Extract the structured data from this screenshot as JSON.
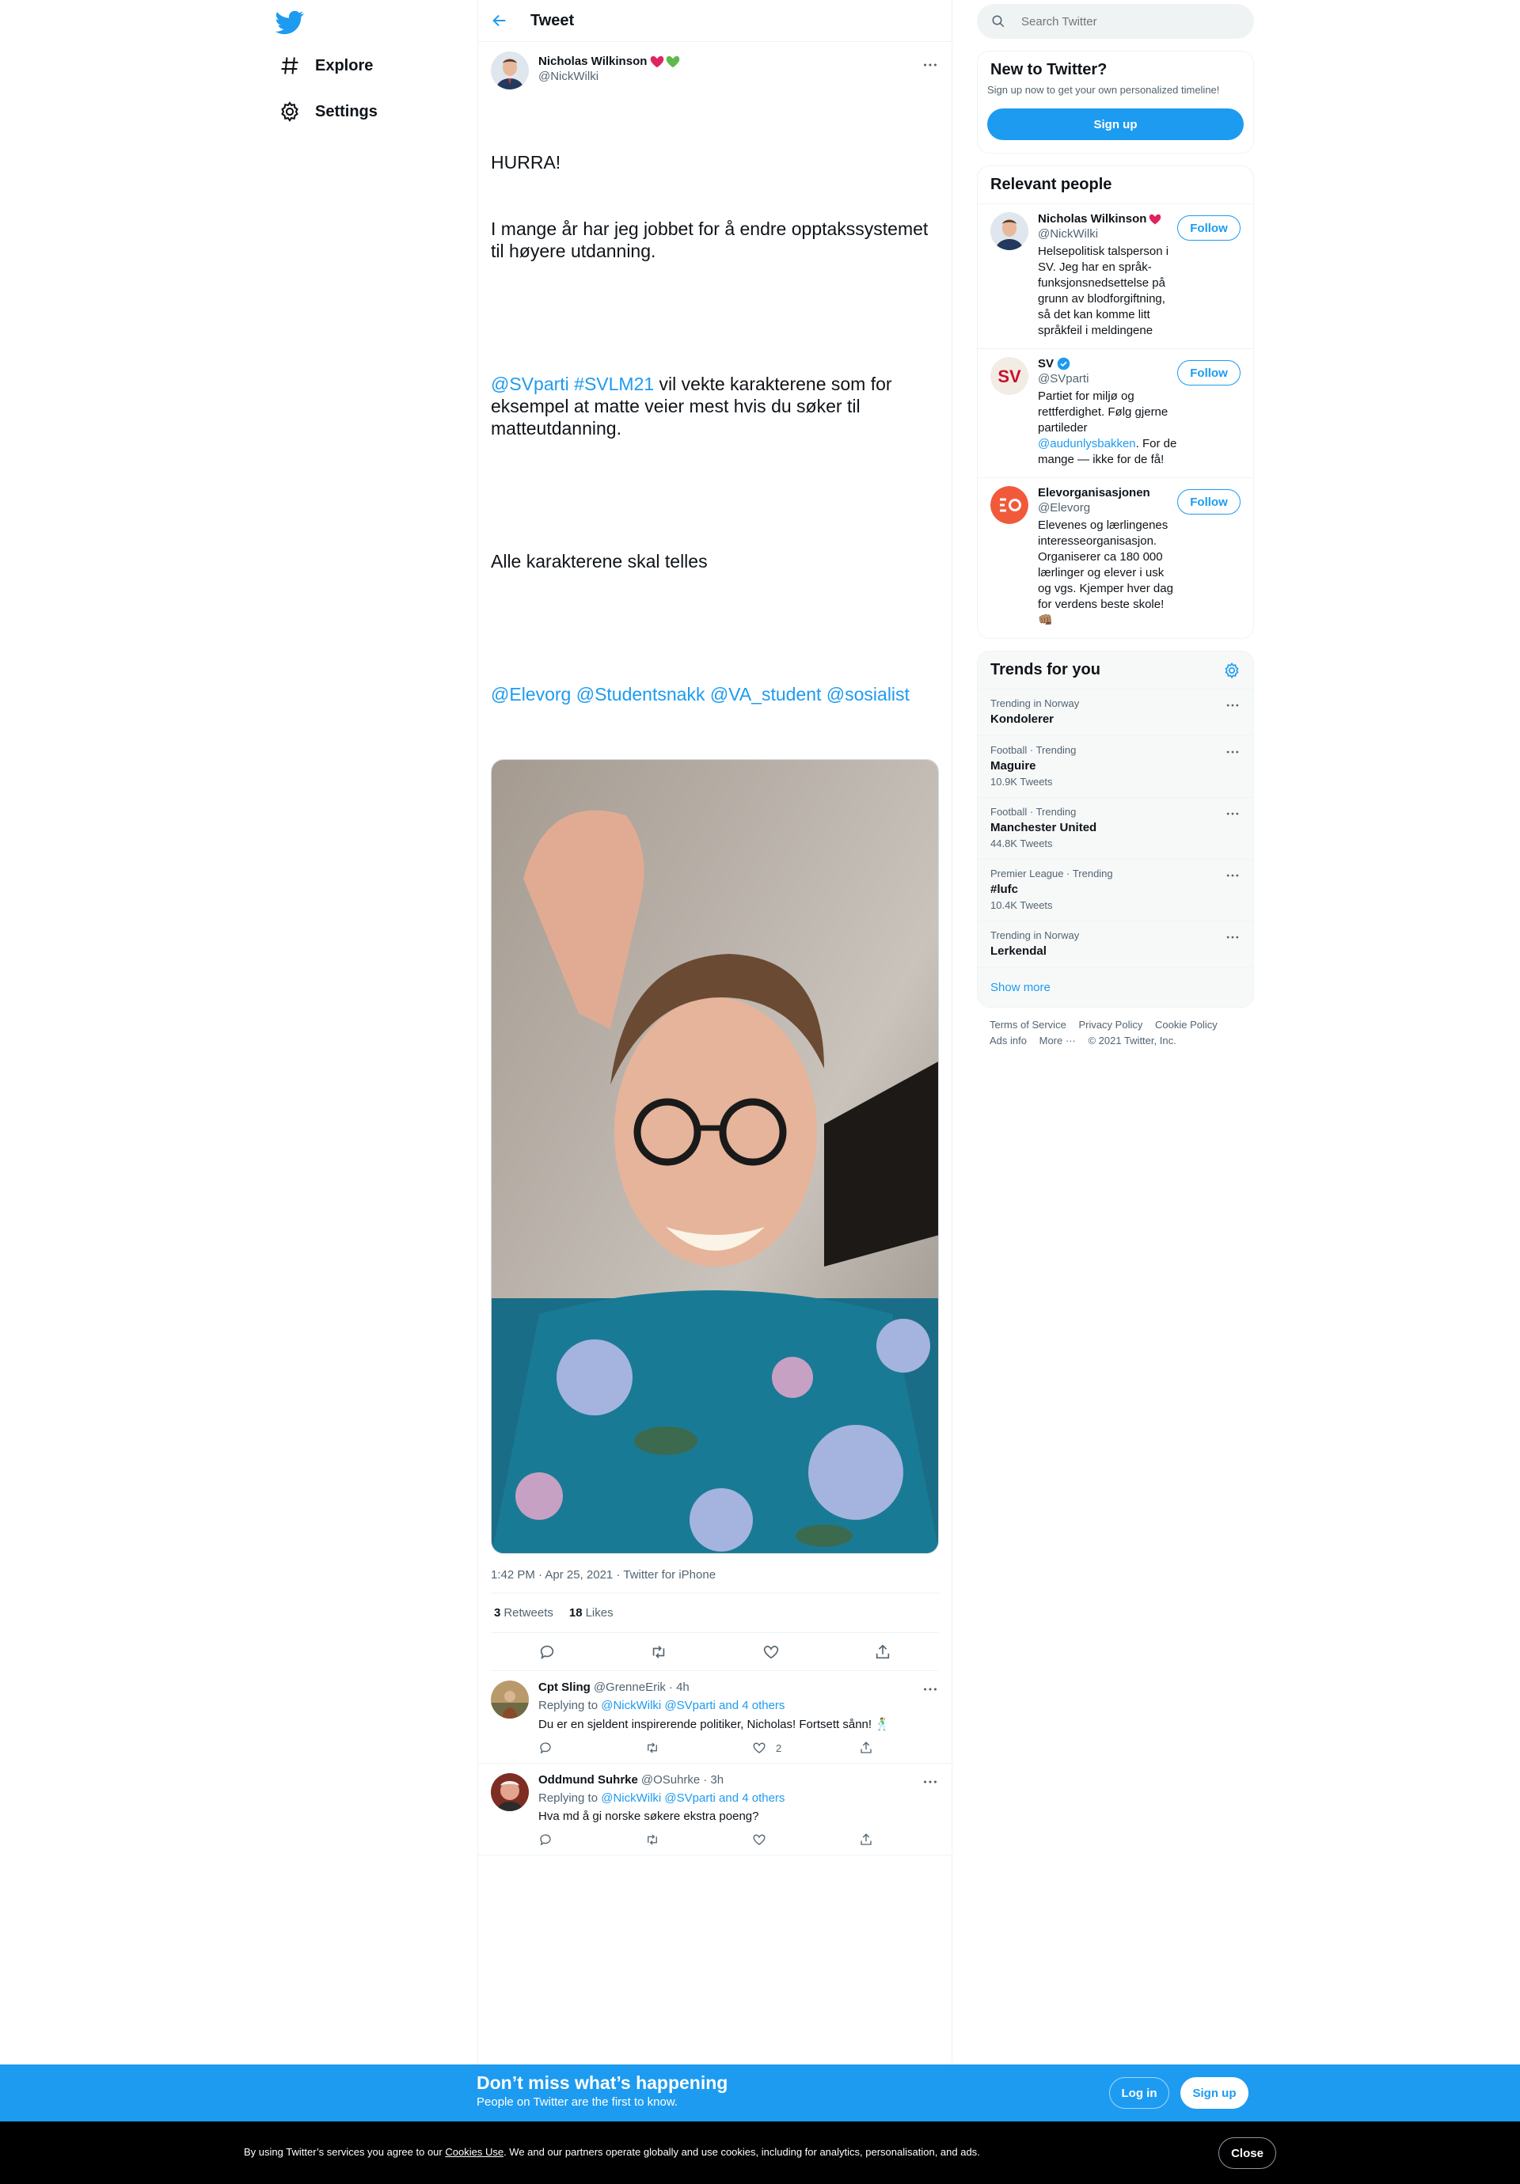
{
  "nav": {
    "logo_icon": "twitter-bird-icon",
    "items": [
      {
        "label": "Explore",
        "icon": "hashtag-icon"
      },
      {
        "label": "Settings",
        "icon": "gear-icon"
      }
    ]
  },
  "header": {
    "title": "Tweet"
  },
  "tweet": {
    "author_name": "Nicholas Wilkinson",
    "author_handle": "@NickWilki",
    "text_lines": [
      "HURRA!",
      "I mange år har jeg jobbet for å endre opptakssystemet til høyere utdanning."
    ],
    "para2_mentions": "@SVparti #SVLM21",
    "para2_text": " vil vekte karakterene som for eksempel at matte veier mest hvis du søker til matteutdanning.",
    "para3": "Alle karakterene skal telles",
    "para4_mentions": "@Elevorg @Studentsnakk @VA_student @sosialist",
    "timestamp": "1:42 PM · Apr 25, 2021 · Twitter for iPhone",
    "retweets_count": "3",
    "retweets_label": "Retweets",
    "likes_count": "18",
    "likes_label": "Likes"
  },
  "replies": [
    {
      "name": "Cpt Sling",
      "handle": "@GrenneErik",
      "time": "· 4h",
      "replying_prefix": "Replying to ",
      "replying_to": "@NickWilki @SVparti and 4 others",
      "text": "Du er en sjeldent inspirerende politiker, Nicholas! Fortsett sånn! 🕺",
      "like_count": "2"
    },
    {
      "name": "Oddmund Suhrke",
      "handle": "@OSuhrke",
      "time": "· 3h",
      "replying_prefix": "Replying to ",
      "replying_to": "@NickWilki @SVparti and 4 others",
      "text": "Hva md å gi norske søkere ekstra poeng?",
      "like_count": ""
    }
  ],
  "search": {
    "placeholder": "Search Twitter"
  },
  "new_to_twitter": {
    "title": "New to Twitter?",
    "subtitle": "Sign up now to get your own personalized timeline!",
    "button": "Sign up"
  },
  "relevant_people": {
    "title": "Relevant people",
    "follow_label": "Follow",
    "people": [
      {
        "name": "Nicholas Wilkinson",
        "handle": "@NickWilki",
        "bio": "Helsepolitisk talsperson i SV. Jeg har en språk-funksjonsnedsettelse på grunn av blodforgiftning, så det kan komme litt språkfeil i meldingene"
      },
      {
        "name": "SV",
        "handle": "@SVparti",
        "bio_before": "Partiet for miljø og rettferdighet. Følg gjerne partileder ",
        "bio_link": "@audunlysbakken",
        "bio_after": ". For de mange — ikke for de få!",
        "avatar_text": "SV"
      },
      {
        "name": "Elevorganisasjonen",
        "handle": "@Elevorg",
        "bio": "Elevenes og lærlingenes interesseorganisasjon. Organiserer ca 180 000 lærlinger og elever i usk og vgs. Kjemper hver dag for verdens beste skole! 👊🏽"
      }
    ]
  },
  "trends": {
    "title": "Trends for you",
    "items": [
      {
        "category": "Trending in Norway",
        "name": "Kondolerer",
        "count": ""
      },
      {
        "category": "Football · Trending",
        "name": "Maguire",
        "count": "10.9K Tweets"
      },
      {
        "category": "Football · Trending",
        "name": "Manchester United",
        "count": "44.8K Tweets"
      },
      {
        "category": "Premier League · Trending",
        "name": "#lufc",
        "count": "10.4K Tweets"
      },
      {
        "category": "Trending in Norway",
        "name": "Lerkendal",
        "count": ""
      }
    ],
    "show_more": "Show more"
  },
  "footer": {
    "links": [
      "Terms of Service",
      "Privacy Policy",
      "Cookie Policy",
      "Ads info",
      "More ···",
      "© 2021 Twitter, Inc."
    ]
  },
  "login_bar": {
    "title": "Don’t miss what’s happening",
    "subtitle": "People on Twitter are the first to know.",
    "login": "Log in",
    "signup": "Sign up"
  },
  "cookie_bar": {
    "before": "By using Twitter’s services you agree to our ",
    "link": "Cookies Use",
    "after": ". We and our partners operate globally and use cookies, including for analytics, personalisation, and ads.",
    "close": "Close"
  },
  "colors": {
    "accent": "#1d9bf0",
    "text": "#0f1419",
    "muted": "#536471",
    "like_heart": "#e0245e",
    "green_heart": "#5fb94b"
  }
}
